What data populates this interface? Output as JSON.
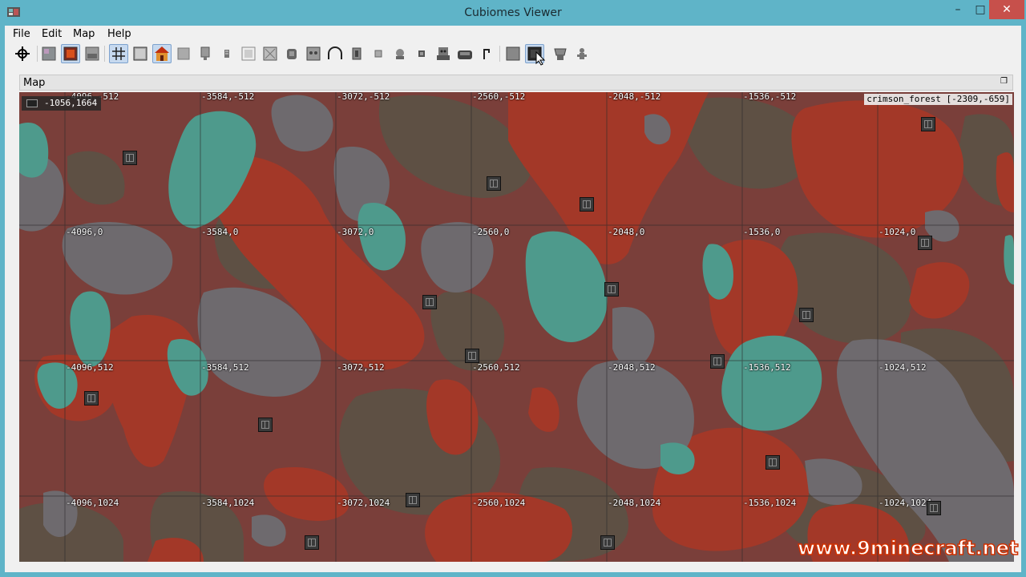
{
  "window": {
    "title": "Cubiomes Viewer"
  },
  "menu": {
    "items": [
      "File",
      "Edit",
      "Map",
      "Help"
    ]
  },
  "toolbar": {
    "buttons": [
      {
        "name": "goto-coordinates",
        "checked": false
      },
      {
        "name": "layer-noise",
        "checked": false
      },
      {
        "name": "nether",
        "checked": true
      },
      {
        "name": "the-end",
        "checked": false
      },
      {
        "name": "grid",
        "checked": true
      },
      {
        "name": "slime-chunks",
        "checked": false
      },
      {
        "name": "village",
        "checked": true
      },
      {
        "name": "desert-pyramid",
        "checked": false
      },
      {
        "name": "jungle-temple",
        "checked": false
      },
      {
        "name": "swamp-hut",
        "checked": false
      },
      {
        "name": "igloo",
        "checked": false
      },
      {
        "name": "ocean-monument",
        "checked": false
      },
      {
        "name": "woodland-mansion",
        "checked": false
      },
      {
        "name": "ocean-ruins",
        "checked": false
      },
      {
        "name": "shipwreck",
        "checked": false
      },
      {
        "name": "ruined-portal",
        "checked": false
      },
      {
        "name": "treasure",
        "checked": false
      },
      {
        "name": "mineshaft",
        "checked": false
      },
      {
        "name": "outpost",
        "checked": false
      },
      {
        "name": "ancient-city",
        "checked": false
      },
      {
        "name": "fortress",
        "checked": false
      },
      {
        "name": "bastion",
        "checked": false
      },
      {
        "name": "end-city",
        "checked": false
      },
      {
        "name": "end-gateway",
        "checked": false
      },
      {
        "name": "spawn",
        "checked": false
      },
      {
        "name": "strongholds",
        "checked": false
      }
    ]
  },
  "dock": {
    "title": "Map"
  },
  "map": {
    "position_readout": "-1056,1664",
    "biome_info": "crimson_forest [-2309,-659]",
    "grid_labels": [
      "-4096,-512",
      "-3584,-512",
      "-3072,-512",
      "-2560,-512",
      "-2048,-512",
      "-1536,-512",
      "-4096,0",
      "-3584,0",
      "-3072,0",
      "-2560,0",
      "-2048,0",
      "-1536,0",
      "-1024,0",
      "-4096,512",
      "-3584,512",
      "-3072,512",
      "-2560,512",
      "-2048,512",
      "-1536,512",
      "-1024,512",
      "-4096,1024",
      "-3584,1024",
      "-3072,1024",
      "-2560,1024",
      "-2048,1024",
      "-1536,1024",
      "-1024,1024"
    ],
    "colors": {
      "nether_wastes": "#7a3f3a",
      "crimson_forest": "#a33828",
      "warped_forest": "#4e9a8c",
      "soul_sand_valley": "#5e5044",
      "basalt_deltas": "#6e6a6e"
    }
  },
  "watermark": "www.9minecraft.net"
}
